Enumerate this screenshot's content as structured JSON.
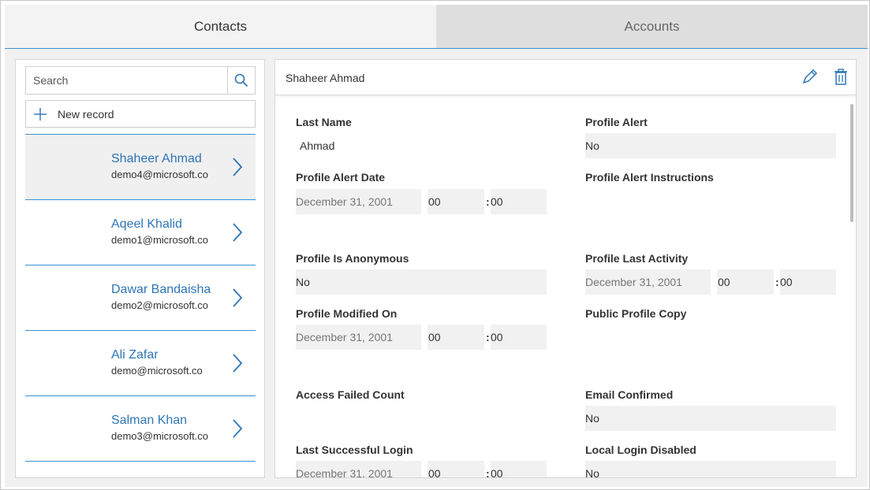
{
  "tabs": [
    {
      "label": "Contacts",
      "active": true
    },
    {
      "label": "Accounts",
      "active": false
    }
  ],
  "search": {
    "placeholder": "Search"
  },
  "new_record_label": "New record",
  "contacts": [
    {
      "name": "Shaheer Ahmad",
      "email": "demo4@microsoft.co",
      "selected": true
    },
    {
      "name": "Aqeel Khalid",
      "email": "demo1@microsoft.co",
      "selected": false
    },
    {
      "name": "Dawar Bandaisha",
      "email": "demo2@microsoft.co",
      "selected": false
    },
    {
      "name": "Ali Zafar",
      "email": "demo@microsoft.co",
      "selected": false
    },
    {
      "name": "Salman Khan",
      "email": "demo3@microsoft.co",
      "selected": false
    }
  ],
  "detail": {
    "title": "Shaheer Ahmad",
    "last_name_label": "Last Name",
    "last_name_value": "Ahmad",
    "profile_alert_label": "Profile Alert",
    "profile_alert_value": "No",
    "profile_alert_date_label": "Profile Alert Date",
    "profile_alert_date_value": "December 31, 2001",
    "profile_alert_date_hour": "00",
    "profile_alert_date_minute": "00",
    "profile_alert_instructions_label": "Profile Alert Instructions",
    "profile_is_anonymous_label": "Profile Is Anonymous",
    "profile_is_anonymous_value": "No",
    "profile_last_activity_label": "Profile Last Activity",
    "profile_last_activity_date": "December 31, 2001",
    "profile_last_activity_hour": "00",
    "profile_last_activity_minute": "00",
    "profile_modified_on_label": "Profile Modified On",
    "profile_modified_on_date": "December 31, 2001",
    "profile_modified_on_hour": "00",
    "profile_modified_on_minute": "00",
    "public_profile_copy_label": "Public Profile Copy",
    "access_failed_count_label": "Access Failed Count",
    "email_confirmed_label": "Email Confirmed",
    "email_confirmed_value": "No",
    "last_successful_login_label": "Last Successful Login",
    "last_successful_login_date": "December 31, 2001",
    "last_successful_login_hour": "00",
    "last_successful_login_minute": "00",
    "local_login_disabled_label": "Local Login Disabled",
    "local_login_disabled_value": "No",
    "time_separator": ":"
  },
  "colors": {
    "accent": "#2e75b6",
    "divider": "#3d8fd1",
    "field_bg": "#f1f1f1"
  },
  "icons": [
    "search-icon",
    "plus-icon",
    "chevron-right-icon",
    "pencil-icon",
    "trash-icon"
  ]
}
